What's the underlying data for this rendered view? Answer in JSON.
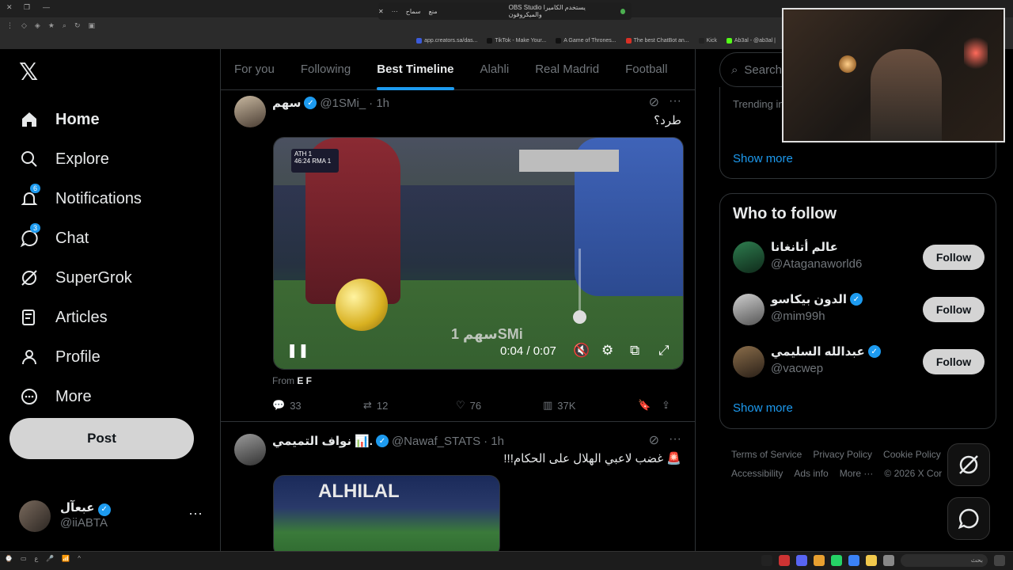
{
  "browser": {
    "notification_title": "OBS Studio يستخدم الكاميرا والميكروفون",
    "notification_allow": "سماح",
    "notification_deny": "منع",
    "bookmarks": [
      {
        "label": "app.creators.sa/das...",
        "color": "#3b5bdb"
      },
      {
        "label": "TikTok - Make Your...",
        "color": "#111111"
      },
      {
        "label": "A Game of Thrones...",
        "color": "#111111"
      },
      {
        "label": "The best ChatBot an...",
        "color": "#d93025"
      },
      {
        "label": "Kick",
        "color": "#222222"
      },
      {
        "label": "Ab3al - @ab3al |",
        "color": "#53fc18"
      }
    ]
  },
  "sidebar": {
    "items": [
      {
        "label": "Home",
        "icon": "home-icon",
        "badge": ""
      },
      {
        "label": "Explore",
        "icon": "search-icon",
        "badge": ""
      },
      {
        "label": "Notifications",
        "icon": "bell-icon",
        "badge": "6"
      },
      {
        "label": "Chat",
        "icon": "chat-icon",
        "badge": "3"
      },
      {
        "label": "SuperGrok",
        "icon": "grok-icon",
        "badge": ""
      },
      {
        "label": "Articles",
        "icon": "articles-icon",
        "badge": ""
      },
      {
        "label": "Profile",
        "icon": "person-icon",
        "badge": ""
      },
      {
        "label": "More",
        "icon": "more-circle-icon",
        "badge": ""
      }
    ],
    "post_label": "Post",
    "account": {
      "name": "عبعآل",
      "handle": "@iiABTA"
    }
  },
  "tabs": [
    "For you",
    "Following",
    "Best Timeline",
    "Alahli",
    "Real Madrid",
    "Football"
  ],
  "tweets": [
    {
      "name": "سهم",
      "handle": "@1SMi_",
      "time": "· 1h",
      "text": "طرد؟",
      "video": {
        "time": "0:04 / 0:07",
        "score_top": "ATH 1",
        "score_bottom": "46:24 RMA 1",
        "watermark": "سهم 1SMi"
      },
      "from_prefix": "From",
      "from_name": "E F",
      "replies": "33",
      "reposts": "12",
      "likes": "76",
      "views": "37K"
    },
    {
      "name": "نواف التميمي",
      "name_suffix": "📊.",
      "handle": "@Nawaf_STATS",
      "time": "· 1h",
      "text": "🚨 غضب لاعبي الهلال على الحكام!!!",
      "media_banner": "ALHILAL"
    }
  ],
  "right": {
    "search_placeholder": "Search",
    "trending_label": "Trending in",
    "show_more": "Show more",
    "who_to_follow_title": "Who to follow",
    "follow_label": "Follow",
    "suggestions": [
      {
        "name": "عالم أتانغانا",
        "handle": "@Ataganaworld6",
        "verified": false
      },
      {
        "name": "الدون بيكاسو",
        "handle": "@mim99h",
        "verified": true
      },
      {
        "name": "عبدالله السليمي",
        "handle": "@vacwep",
        "verified": true
      }
    ],
    "footer": [
      "Terms of Service",
      "Privacy Policy",
      "Cookie Policy",
      "Accessibility",
      "Ads info",
      "More ···",
      "© 2026 X Cor"
    ]
  },
  "taskbar": {
    "search_label": "بحث"
  }
}
